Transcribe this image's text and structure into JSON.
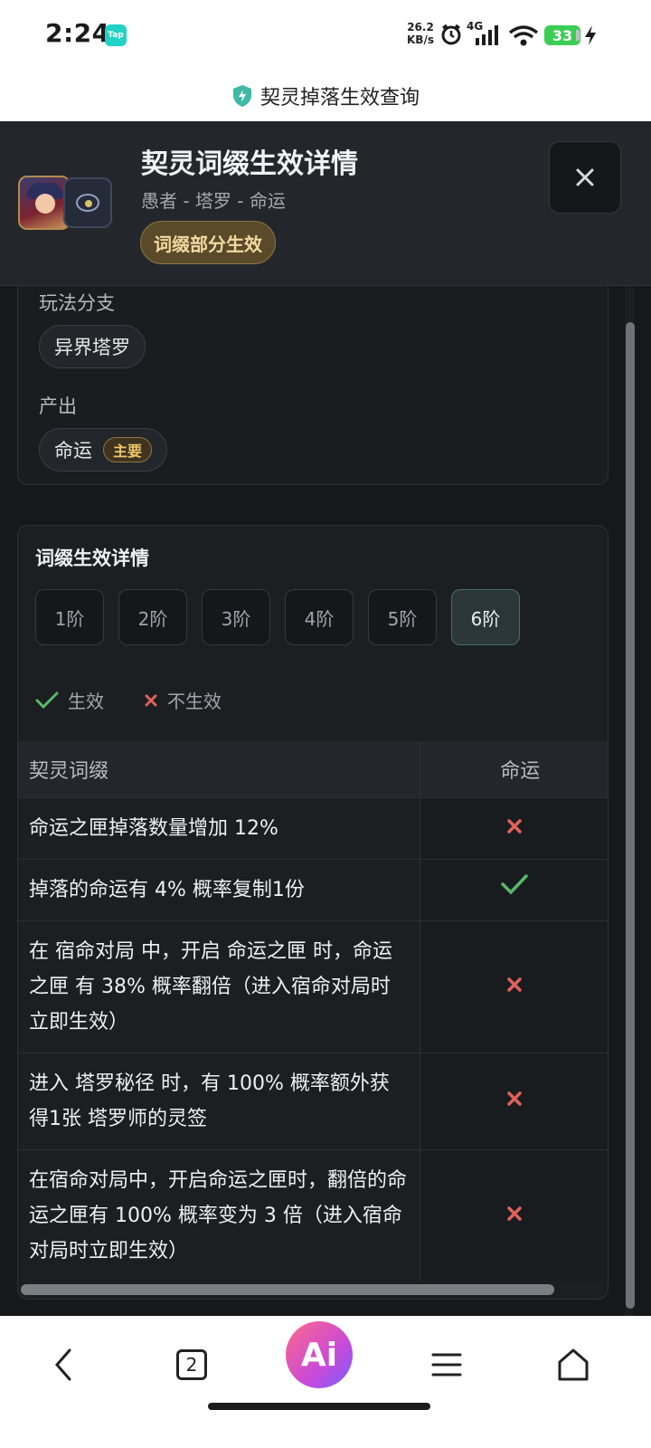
{
  "status_bar": {
    "time": "2:24",
    "tap_badge": "Tap",
    "net_speed_value": "26.2",
    "net_speed_unit": "KB/s",
    "network_type": "4G",
    "battery": "33"
  },
  "browser": {
    "page_title": "契灵掉落生效查询"
  },
  "header": {
    "title": "契灵词缀生效详情",
    "subtitle": "愚者 - 塔罗 - 命运",
    "status_badge": "词缀部分生效"
  },
  "info_card": {
    "branch_label": "玩法分支",
    "branch_value": "异界塔罗",
    "output_label": "产出",
    "output_value": "命运",
    "output_tag": "主要"
  },
  "detail_card": {
    "title": "词缀生效详情",
    "tiers": [
      "1阶",
      "2阶",
      "3阶",
      "4阶",
      "5阶",
      "6阶"
    ],
    "active_tier": "6阶",
    "legend": {
      "effective": "生效",
      "not_effective": "不生效"
    },
    "table": {
      "headers": [
        "契灵词缀",
        "命运"
      ],
      "rows": [
        {
          "affix": "命运之匣掉落数量增加 12%",
          "effective": false
        },
        {
          "affix": "掉落的命运有 4% 概率复制1份",
          "effective": true
        },
        {
          "affix": "在 宿命对局 中，开启 命运之匣 时，命运之匣 有 38% 概率翻倍（进入宿命对局时立即生效）",
          "effective": false
        },
        {
          "affix": "进入 塔罗秘径 时，有 100% 概率额外获得1张 塔罗师的灵签",
          "effective": false
        },
        {
          "affix": "在宿命对局中，开启命运之匣时，翻倍的命运之匣有 100% 概率变为 3 倍（进入宿命对局时立即生效）",
          "effective": false
        }
      ]
    }
  },
  "bottom_nav": {
    "tabs_count": "2",
    "ai_label": "Ai"
  },
  "colors": {
    "effective_check": "#57b86a",
    "not_effective_cross": "#e0625c",
    "badge_gold": "#f3d9a0"
  }
}
